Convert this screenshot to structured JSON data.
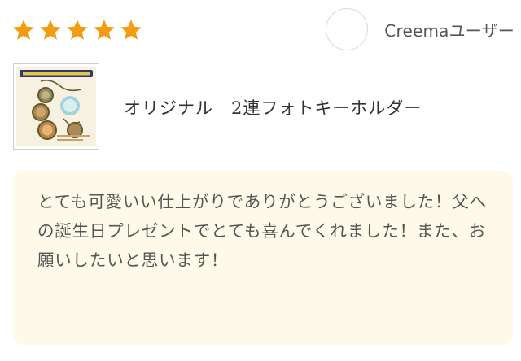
{
  "rating": {
    "value": 5,
    "max": 5,
    "star_color": "#f39c12"
  },
  "user": {
    "name": "Creemaユーザー"
  },
  "product": {
    "title": "オリジナル　2連フォトキーホルダー",
    "thumbnail_icon": "photo-keychain-thumbnail"
  },
  "review": {
    "text": "とても可愛いい仕上がりでありがとうございました！父への誕生日プレゼントでとても喜んでくれました！また、お願いしたいと思います！"
  }
}
